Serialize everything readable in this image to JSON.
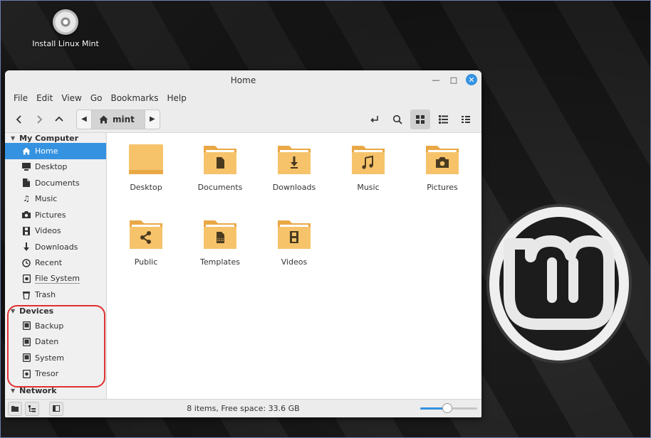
{
  "desktop": {
    "icon_label": "Install Linux Mint"
  },
  "window": {
    "title": "Home"
  },
  "menubar": [
    "File",
    "Edit",
    "View",
    "Go",
    "Bookmarks",
    "Help"
  ],
  "pathbar": {
    "crumb": "mint"
  },
  "sidebar": {
    "my_computer": {
      "header": "My Computer",
      "items": [
        {
          "label": "Home",
          "icon": "home-icon",
          "selected": true
        },
        {
          "label": "Desktop",
          "icon": "desktop-icon"
        },
        {
          "label": "Documents",
          "icon": "document-icon"
        },
        {
          "label": "Music",
          "icon": "music-icon"
        },
        {
          "label": "Pictures",
          "icon": "camera-icon"
        },
        {
          "label": "Videos",
          "icon": "film-icon"
        },
        {
          "label": "Downloads",
          "icon": "download-icon"
        },
        {
          "label": "Recent",
          "icon": "clock-icon"
        },
        {
          "label": "File System",
          "icon": "drive-icon"
        },
        {
          "label": "Trash",
          "icon": "trash-icon"
        }
      ]
    },
    "devices": {
      "header": "Devices",
      "items": [
        {
          "label": "Backup",
          "icon": "drive-icon"
        },
        {
          "label": "Daten",
          "icon": "drive-icon"
        },
        {
          "label": "System",
          "icon": "drive-icon"
        },
        {
          "label": "Tresor",
          "icon": "drive-icon"
        }
      ]
    },
    "network": {
      "header": "Network"
    }
  },
  "files": [
    {
      "name": "Desktop",
      "emblem": "none"
    },
    {
      "name": "Documents",
      "emblem": "document"
    },
    {
      "name": "Downloads",
      "emblem": "download"
    },
    {
      "name": "Music",
      "emblem": "music"
    },
    {
      "name": "Pictures",
      "emblem": "camera"
    },
    {
      "name": "Public",
      "emblem": "share"
    },
    {
      "name": "Templates",
      "emblem": "template"
    },
    {
      "name": "Videos",
      "emblem": "film"
    }
  ],
  "status": {
    "text": "8 items, Free space: 33.6 GB",
    "zoom_fraction": 0.48
  },
  "colors": {
    "accent": "#3592e1",
    "folder": "#f6c36b",
    "folder_dark": "#e9a846"
  }
}
